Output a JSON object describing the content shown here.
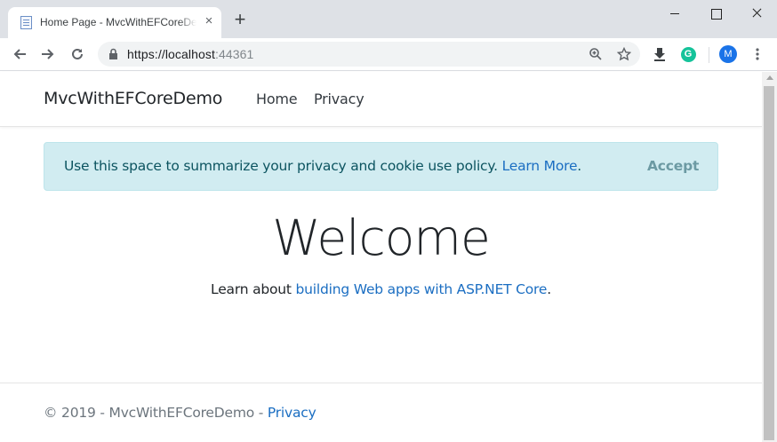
{
  "browser": {
    "tab_title": "Home Page - MvcWithEFCoreDemo",
    "tab_close": "×",
    "new_tab": "+",
    "url_main": "https://localhost",
    "url_port": ":44361",
    "extension_label": "G",
    "profile_initial": "M"
  },
  "navbar": {
    "brand": "MvcWithEFCoreDemo",
    "links": [
      "Home",
      "Privacy"
    ]
  },
  "cookie_banner": {
    "text": "Use this space to summarize your privacy and cookie use policy.",
    "link": "Learn More",
    "after_link": ".",
    "accept": "Accept"
  },
  "main": {
    "heading": "Welcome",
    "learn_prefix": "Learn about",
    "learn_link": "building Web apps with ASP.NET Core",
    "learn_suffix": "."
  },
  "footer": {
    "text": "© 2019 - MvcWithEFCoreDemo -",
    "link": "Privacy"
  },
  "colors": {
    "link": "#1b6ec2",
    "alert_bg": "#d1ecf1",
    "alert_text": "#0c5460",
    "chrome_bg": "#dee1e6"
  }
}
